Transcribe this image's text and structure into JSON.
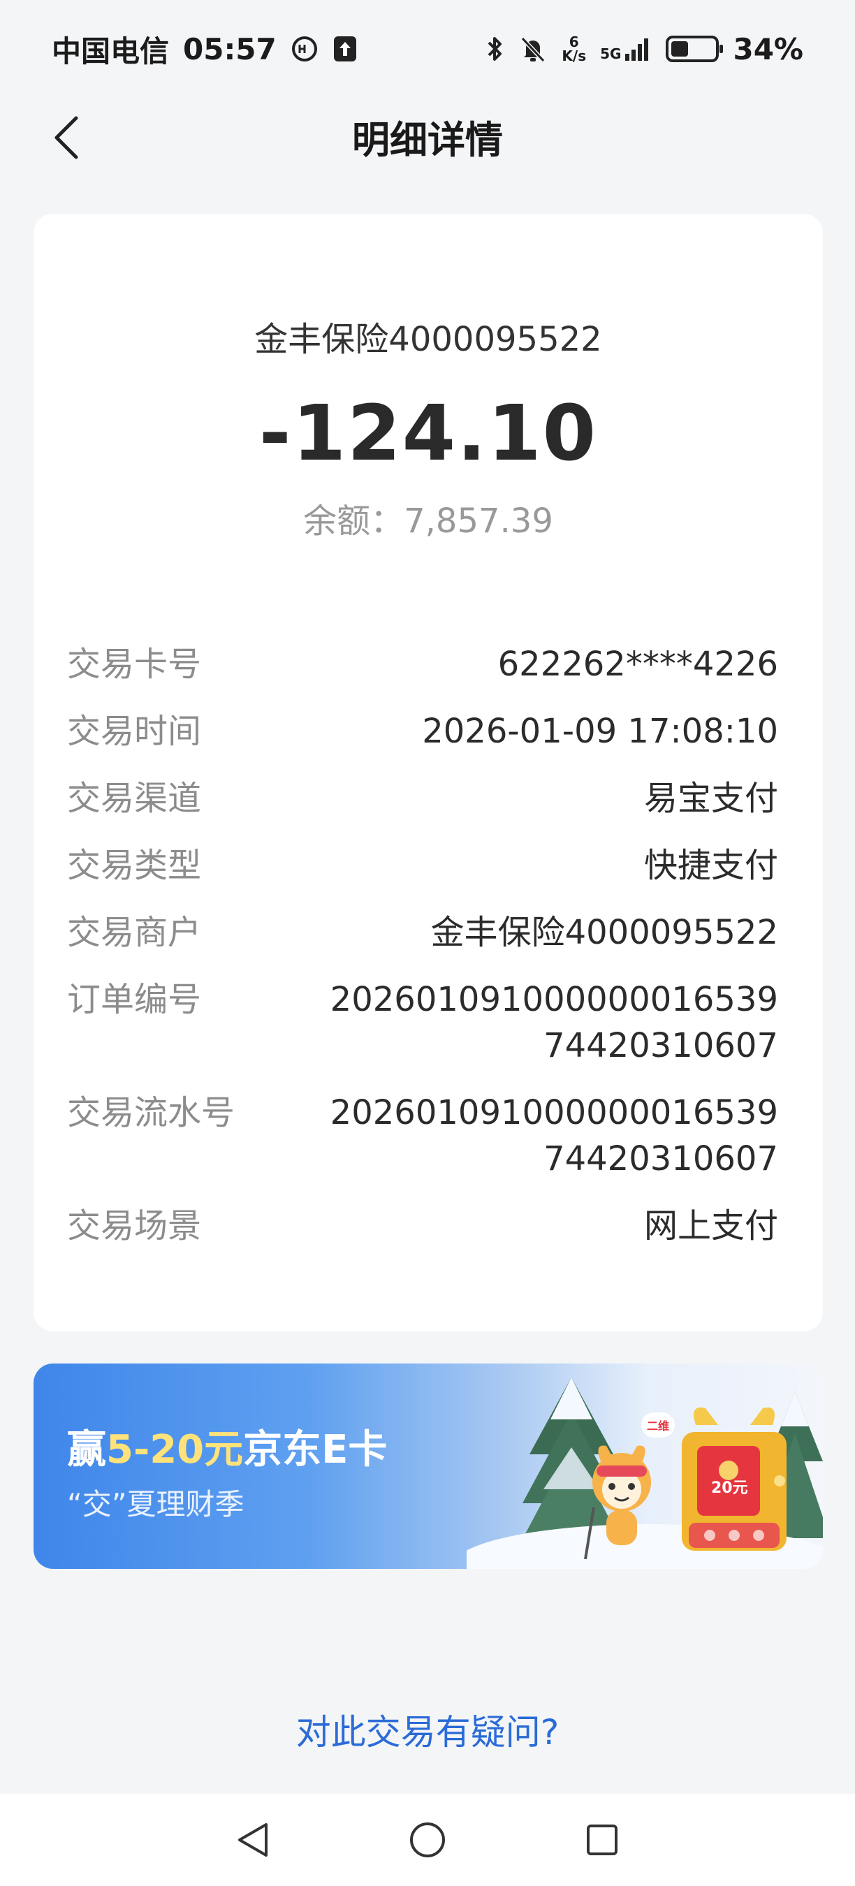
{
  "status_bar": {
    "carrier": "中国电信",
    "time": "05:57",
    "speed_value": "6",
    "speed_unit": "K/s",
    "network": "5G",
    "battery": "34%"
  },
  "header": {
    "title": "明细详情"
  },
  "transaction": {
    "merchant_title": "金丰保险4000095522",
    "amount": "-124.10",
    "balance": "余额：7,857.39",
    "rows": [
      {
        "label": "交易卡号",
        "value": "622262****4226"
      },
      {
        "label": "交易时间",
        "value": "2026-01-09 17:08:10"
      },
      {
        "label": "交易渠道",
        "value": "易宝支付"
      },
      {
        "label": "交易类型",
        "value": "快捷支付"
      },
      {
        "label": "交易商户",
        "value": "金丰保险4000095522"
      },
      {
        "label": "订单编号",
        "value_line1": "202601091000000016539",
        "value_line2": "74420310607"
      },
      {
        "label": "交易流水号",
        "value_line1": "202601091000000016539",
        "value_line2": "74420310607"
      },
      {
        "label": "交易场景",
        "value": "网上支付"
      }
    ]
  },
  "banner": {
    "title_pre": "赢",
    "title_highlight": "5-20元",
    "title_post": "京东E卡",
    "subtitle": "“交”夏理财季",
    "gift_amount": "20元",
    "badge": "二维"
  },
  "question_link": "对此交易有疑问?",
  "colors": {
    "link": "#2a6bd7",
    "banner_start": "#3f86ea",
    "highlight": "#ffe27a"
  }
}
